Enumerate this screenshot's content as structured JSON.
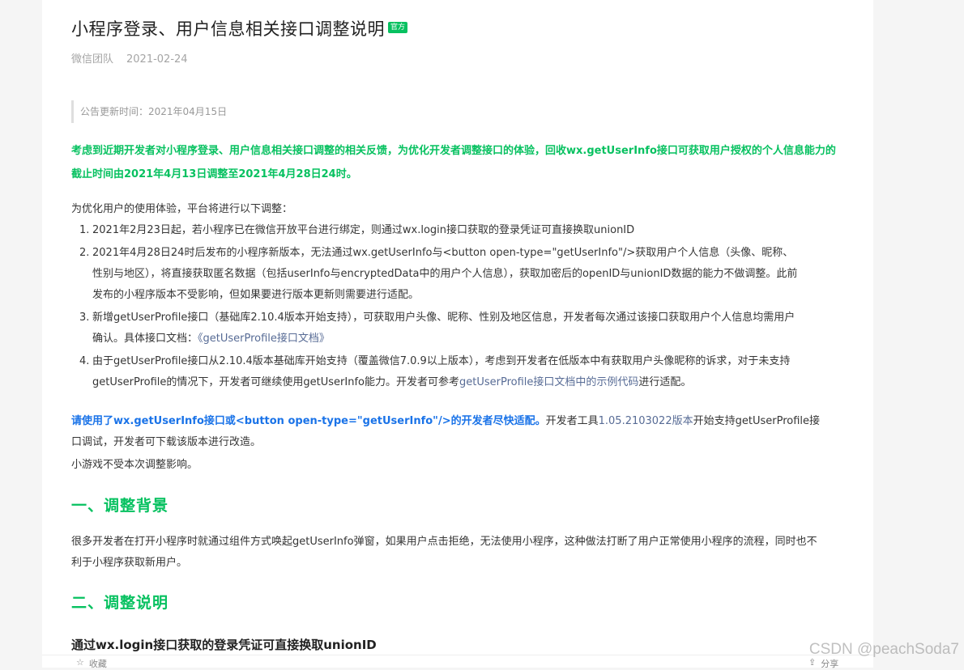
{
  "article": {
    "title": "小程序登录、用户信息相关接口调整说明",
    "badge": "官方",
    "author": "微信团队",
    "date": "2021-02-24",
    "notice": "公告更新时间：2021年04月15日",
    "highlight": "考虑到近期开发者对小程序登录、用户信息相关接口调整的相关反馈，为优化开发者调整接口的体验，回收wx.getUserInfo接口可获取用户授权的个人信息能力的截止时间由2021年4月13日调整至2021年4月28日24时。",
    "intro": "为优化用户的使用体验，平台将进行以下调整：",
    "items": [
      {
        "num": "1.",
        "text": "2021年2月23日起，若小程序已在微信开放平台进行绑定，则通过wx.login接口获取的登录凭证可直接换取unionID"
      },
      {
        "num": "2.",
        "text": "2021年4月28日24时后发布的小程序新版本，无法通过wx.getUserInfo与<button open-type=\"getUserInfo\"/>获取用户个人信息（头像、昵称、性别与地区），将直接获取匿名数据（包括userInfo与encryptedData中的用户个人信息），获取加密后的openID与unionID数据的能力不做调整。此前发布的小程序版本不受影响，但如果要进行版本更新则需要进行适配。"
      },
      {
        "num": "3.",
        "text": "新增getUserProfile接口（基础库2.10.4版本开始支持），可获取用户头像、昵称、性别及地区信息，开发者每次通过该接口获取用户个人信息均需用户确认。具体接口文档：",
        "link": "《getUserProfile接口文档》"
      },
      {
        "num": "4.",
        "text": "由于getUserProfile接口从2.10.4版本基础库开始支持（覆盖微信7.0.9以上版本），考虑到开发者在低版本中有获取用户头像昵称的诉求，对于未支持getUserProfile的情况下，开发者可继续使用getUserInfo能力。开发者可参考",
        "link": "getUserProfile接口文档中的示例代码",
        "tail": "进行适配。"
      }
    ],
    "adapt_bold": "请使用了wx.getUserInfo接口或<button open-type=\"getUserInfo\"/>的开发者尽快适配。",
    "adapt_text1": "开发者工具",
    "adapt_link": "1.05.2103022版本",
    "adapt_text2": "开始支持getUserProfile接口调试，开发者可下载该版本进行改造。",
    "minigame_note": "小游戏不受本次调整影响。",
    "section1_title": "一、调整背景",
    "section1_text": "很多开发者在打开小程序时就通过组件方式唤起getUserInfo弹窗，如果用户点击拒绝，无法使用小程序，这种做法打断了用户正常使用小程序的流程，同时也不利于小程序获取新用户。",
    "section2_title": "二、调整说明",
    "sub_heading": "通过wx.login接口获取的登录凭证可直接换取unionID"
  },
  "bottom_bar": {
    "left_label": "收藏",
    "right_label": "分享"
  },
  "watermark": "CSDN @peachSoda7",
  "colors": {
    "accent_green": "#07c160",
    "link_blue": "#576b95",
    "bold_blue": "#1a73e8"
  },
  "icons": {
    "left": "star-icon",
    "right": "share-icon"
  }
}
